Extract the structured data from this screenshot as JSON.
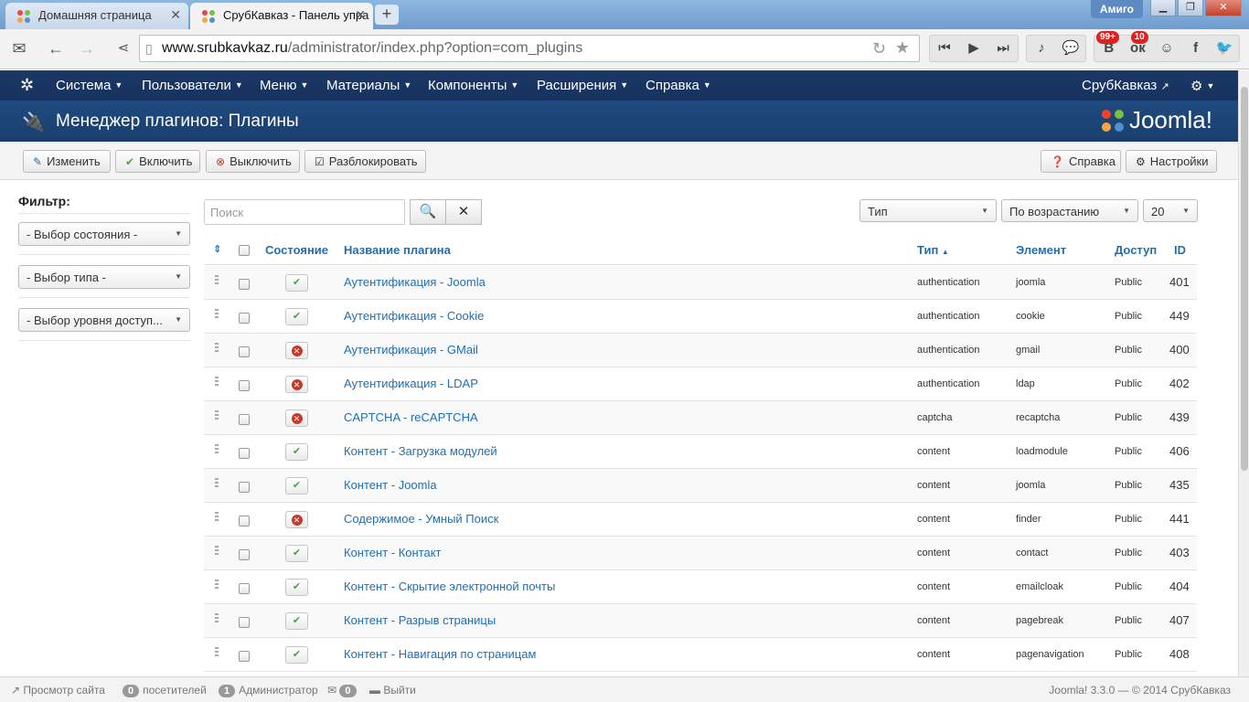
{
  "browser": {
    "tabs": [
      {
        "label": "Домашняя страница",
        "active": false
      },
      {
        "label": "СрубКавказ - Панель упра",
        "active": true
      }
    ],
    "user": "Амиго",
    "url_host": "www.srubkavkaz.ru",
    "url_path": "/administrator/index.php?option=com_plugins",
    "badges": {
      "vk": "99+",
      "ok": "10"
    }
  },
  "nav": {
    "items": [
      "Система",
      "Пользователи",
      "Меню",
      "Материалы",
      "Компоненты",
      "Расширения",
      "Справка"
    ],
    "site_link": "СрубКавказ"
  },
  "header": {
    "title": "Менеджер плагинов: Плагины",
    "brand": "Joomla!"
  },
  "toolbar": {
    "edit": "Изменить",
    "enable": "Включить",
    "disable": "Выключить",
    "unlock": "Разблокировать",
    "help": "Справка",
    "options": "Настройки"
  },
  "sidebar": {
    "title": "Фильтр:",
    "state": "- Выбор состояния -",
    "type": "- Выбор типа -",
    "access": "- Выбор уровня доступ..."
  },
  "search": {
    "placeholder": "Поиск"
  },
  "list_controls": {
    "sort_field": "Тип",
    "direction": "По возрастанию",
    "limit": "20"
  },
  "table": {
    "headers": {
      "state": "Состояние",
      "name": "Название плагина",
      "type": "Тип",
      "element": "Элемент",
      "access": "Доступ",
      "id": "ID"
    },
    "rows": [
      {
        "name": "Аутентификация - Joomla",
        "enabled": true,
        "type": "authentication",
        "element": "joomla",
        "access": "Public",
        "id": "401"
      },
      {
        "name": "Аутентификация - Cookie",
        "enabled": true,
        "type": "authentication",
        "element": "cookie",
        "access": "Public",
        "id": "449"
      },
      {
        "name": "Аутентификация - GMail",
        "enabled": false,
        "type": "authentication",
        "element": "gmail",
        "access": "Public",
        "id": "400"
      },
      {
        "name": "Аутентификация - LDAP",
        "enabled": false,
        "type": "authentication",
        "element": "ldap",
        "access": "Public",
        "id": "402"
      },
      {
        "name": "CAPTCHA - reCAPTCHA",
        "enabled": false,
        "type": "captcha",
        "element": "recaptcha",
        "access": "Public",
        "id": "439"
      },
      {
        "name": "Контент - Загрузка модулей",
        "enabled": true,
        "type": "content",
        "element": "loadmodule",
        "access": "Public",
        "id": "406"
      },
      {
        "name": "Контент - Joomla",
        "enabled": true,
        "type": "content",
        "element": "joomla",
        "access": "Public",
        "id": "435"
      },
      {
        "name": "Содержимое - Умный Поиск",
        "enabled": false,
        "type": "content",
        "element": "finder",
        "access": "Public",
        "id": "441"
      },
      {
        "name": "Контент - Контакт",
        "enabled": true,
        "type": "content",
        "element": "contact",
        "access": "Public",
        "id": "403"
      },
      {
        "name": "Контент - Скрытие электронной почты",
        "enabled": true,
        "type": "content",
        "element": "emailcloak",
        "access": "Public",
        "id": "404"
      },
      {
        "name": "Контент - Разрыв страницы",
        "enabled": true,
        "type": "content",
        "element": "pagebreak",
        "access": "Public",
        "id": "407"
      },
      {
        "name": "Контент - Навигация по страницам",
        "enabled": true,
        "type": "content",
        "element": "pagenavigation",
        "access": "Public",
        "id": "408"
      }
    ]
  },
  "statusbar": {
    "view_site": "Просмотр сайта",
    "visitors_count": "0",
    "visitors": "посетителей",
    "admins_count": "1",
    "admins": "Администратор",
    "messages_count": "0",
    "logout": "Выйти",
    "copyright": "Joomla! 3.3.0 — © 2014 СрубКавказ"
  },
  "colors": {
    "nav_bg": "#1a3867",
    "title_bg": "#1f4a7f",
    "link": "#1f6fb2",
    "enabled": "#46a546",
    "disabled": "#c7382b"
  }
}
